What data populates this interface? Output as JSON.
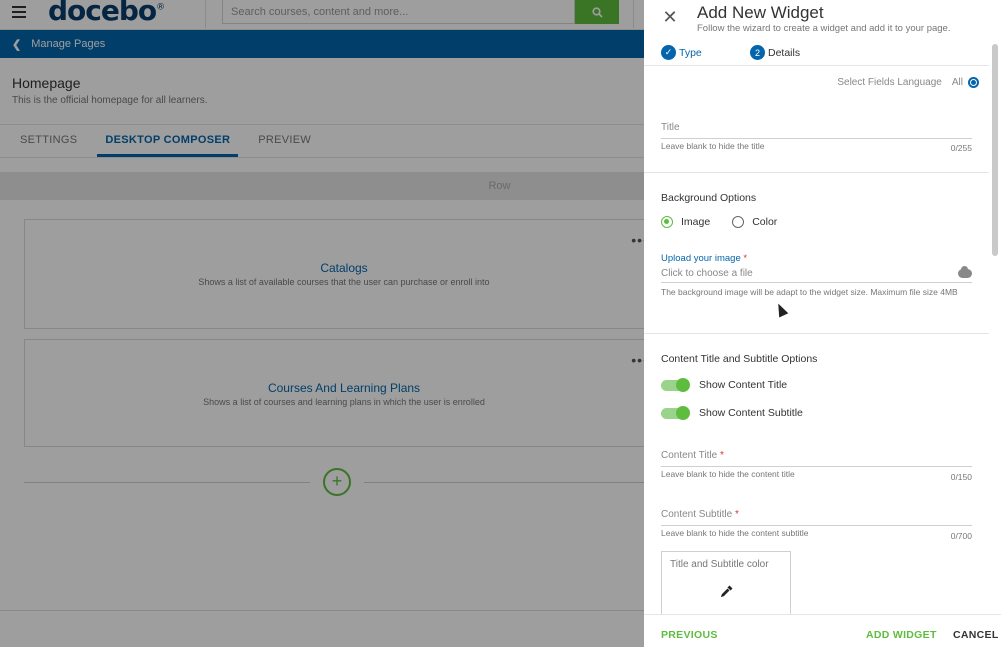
{
  "app": {
    "logo": "docebo",
    "logo_mark": "®",
    "search_placeholder": "Search courses, content and more...",
    "icons": {
      "menu": "hamburger-icon",
      "search": "search-icon"
    }
  },
  "breadcrumb": {
    "back_label": "Manage Pages"
  },
  "page": {
    "title": "Homepage",
    "description": "This is the official homepage for all learners."
  },
  "tabs": [
    {
      "label": "SETTINGS",
      "active": false
    },
    {
      "label": "DESKTOP COMPOSER",
      "active": true
    },
    {
      "label": "PREVIEW",
      "active": false
    }
  ],
  "row_label": "Row",
  "widgets": [
    {
      "title": "Catalogs",
      "description": "Shows a list of available courses that the user can purchase or enroll into",
      "menu": "•••"
    },
    {
      "title": "Courses And Learning Plans",
      "description": "Shows a list of courses and learning plans in which the user is enrolled",
      "menu": "•••"
    }
  ],
  "add_row_symbol": "+",
  "panel": {
    "title": "Add New Widget",
    "subtitle": "Follow the wizard to create a widget and add it to your page.",
    "close_symbol": "✕",
    "steps": [
      {
        "marker": "✓",
        "label": "Type",
        "state": "done"
      },
      {
        "marker": "2",
        "label": "Details",
        "state": "current"
      }
    ],
    "language": {
      "label": "Select Fields Language",
      "value": "All"
    },
    "title_field": {
      "label": "Title",
      "hint": "Leave blank to hide the title",
      "count": "0/255"
    },
    "background": {
      "heading": "Background Options",
      "options": [
        {
          "label": "Image",
          "selected": true
        },
        {
          "label": "Color",
          "selected": false
        }
      ],
      "upload_label": "Upload your image",
      "upload_required": "*",
      "upload_placeholder": "Click to choose a file",
      "upload_hint": "The background image will be adapt to the widget size. Maximum file size 4MB"
    },
    "content_options": {
      "heading": "Content Title and Subtitle Options",
      "toggles": [
        {
          "label": "Show Content Title",
          "on": true
        },
        {
          "label": "Show Content Subtitle",
          "on": true
        }
      ]
    },
    "content_title": {
      "label": "Content Title",
      "required": "*",
      "hint": "Leave blank to hide the content title",
      "count": "0/150"
    },
    "content_subtitle": {
      "label": "Content Subtitle",
      "required": "*",
      "hint": "Leave blank to hide the content subtitle",
      "count": "0/700"
    },
    "color_picker": {
      "label": "Title and Subtitle color"
    },
    "footer": {
      "previous": "PREVIOUS",
      "add": "ADD WIDGET",
      "cancel": "CANCEL"
    }
  },
  "colors": {
    "brand_blue": "#0465ac",
    "accent_green": "#5ebd3e",
    "logo_navy": "#0a3d6b"
  }
}
